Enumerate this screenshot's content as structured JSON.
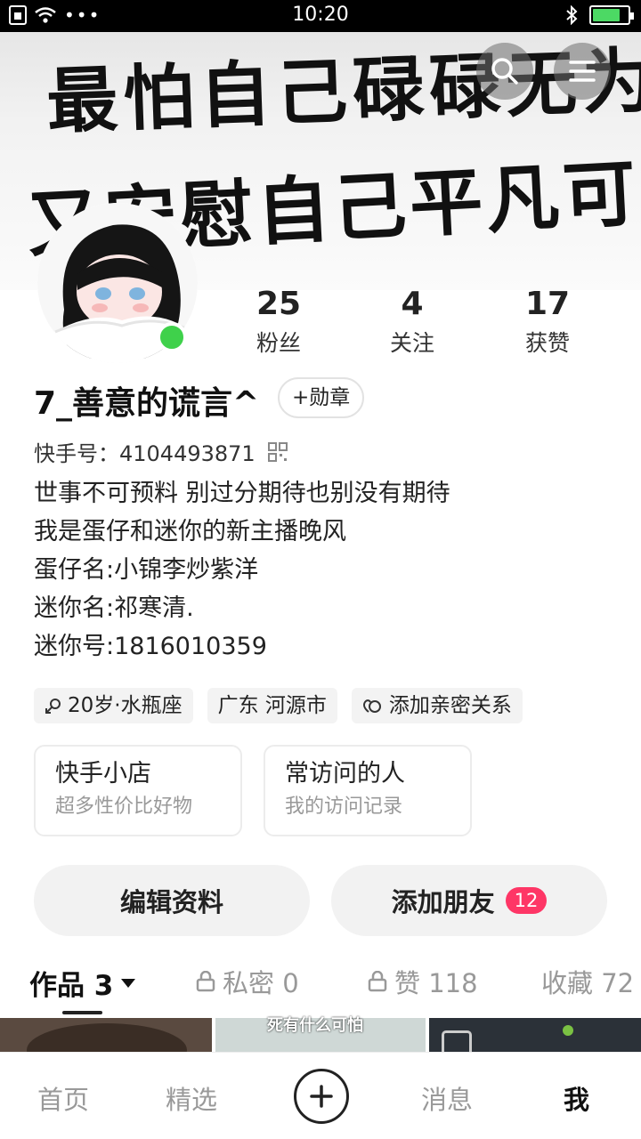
{
  "status_bar": {
    "time": "10:20",
    "battery_level": 0.8
  },
  "banner": {
    "line1": "最怕自己碌碌无为",
    "line2": "又安慰自己平凡可贵"
  },
  "header": {
    "search_icon": "search-icon",
    "menu_icon": "menu-icon"
  },
  "profile": {
    "name": "7_善意的谎言^",
    "badge_button": "+勋章",
    "kuaishou_id": "快手号：4104493871",
    "online": true,
    "bio": [
      "世事不可预料 别过分期待也别没有期待",
      "我是蛋仔和迷你的新主播晚风",
      "蛋仔名:小锦李炒紫洋",
      "迷你名:祁寒清.",
      "迷你号:1816010359"
    ],
    "tags": [
      "20岁·水瓶座",
      "广东 河源市",
      "添加亲密关系"
    ]
  },
  "stats": [
    {
      "value": "25",
      "label": "粉丝"
    },
    {
      "value": "4",
      "label": "关注"
    },
    {
      "value": "17",
      "label": "获赞"
    }
  ],
  "cards": [
    {
      "title": "快手小店",
      "subtitle": "超多性价比好物"
    },
    {
      "title": "常访问的人",
      "subtitle": "我的访问记录"
    }
  ],
  "actions": {
    "edit": "编辑资料",
    "add_friends": "添加朋友",
    "friend_count": "12"
  },
  "tabs": [
    {
      "label": "作品 3"
    },
    {
      "label": "私密 0"
    },
    {
      "label": "赞 118"
    },
    {
      "label": "收藏 72"
    }
  ],
  "thumb_caption": "死有什么可怕",
  "bottom_nav": [
    "首页",
    "精选",
    "消息",
    "我"
  ],
  "colors": {
    "accent": "#fe3666",
    "online": "#3fd14b"
  }
}
